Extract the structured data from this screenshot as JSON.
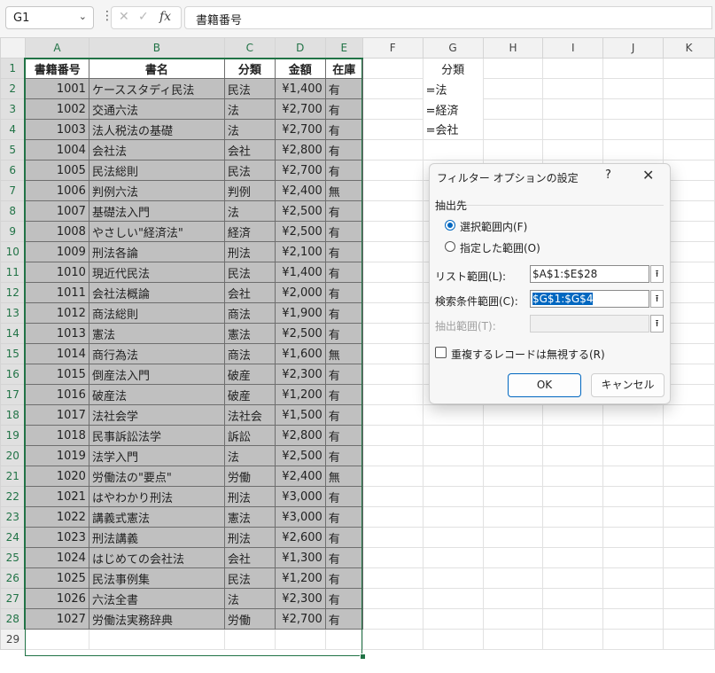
{
  "formula_bar": {
    "name_box": "G1",
    "formula": "書籍番号",
    "fx_label": "fx",
    "cancel_glyph": "✕",
    "enter_glyph": "✓",
    "separator": "⋮",
    "dropdown_glyph": "⌄"
  },
  "columns": [
    "A",
    "B",
    "C",
    "D",
    "E",
    "F",
    "G",
    "H",
    "I",
    "J",
    "K"
  ],
  "rows": [
    "1",
    "2",
    "3",
    "4",
    "5",
    "6",
    "7",
    "8",
    "9",
    "10",
    "11",
    "12",
    "13",
    "14",
    "15",
    "16",
    "17",
    "18",
    "19",
    "20",
    "21",
    "22",
    "23",
    "24",
    "25",
    "26",
    "27",
    "28",
    "29"
  ],
  "table": {
    "headers": [
      "書籍番号",
      "書名",
      "分類",
      "金額",
      "在庫"
    ],
    "data": [
      [
        "1001",
        "ケーススタディ民法",
        "民法",
        "¥1,400",
        "有"
      ],
      [
        "1002",
        "交通六法",
        "法",
        "¥2,700",
        "有"
      ],
      [
        "1003",
        "法人税法の基礎",
        "法",
        "¥2,700",
        "有"
      ],
      [
        "1004",
        "会社法",
        "会社",
        "¥2,800",
        "有"
      ],
      [
        "1005",
        "民法総則",
        "民法",
        "¥2,700",
        "有"
      ],
      [
        "1006",
        "判例六法",
        "判例",
        "¥2,400",
        "無"
      ],
      [
        "1007",
        "基礎法入門",
        "法",
        "¥2,500",
        "有"
      ],
      [
        "1008",
        "やさしい\"経済法\"",
        "経済",
        "¥2,500",
        "有"
      ],
      [
        "1009",
        "刑法各論",
        "刑法",
        "¥2,100",
        "有"
      ],
      [
        "1010",
        "現近代民法",
        "民法",
        "¥1,400",
        "有"
      ],
      [
        "1011",
        "会社法概論",
        "会社",
        "¥2,000",
        "有"
      ],
      [
        "1012",
        "商法総則",
        "商法",
        "¥1,900",
        "有"
      ],
      [
        "1013",
        "憲法",
        "憲法",
        "¥2,500",
        "有"
      ],
      [
        "1014",
        "商行為法",
        "商法",
        "¥1,600",
        "無"
      ],
      [
        "1015",
        "倒産法入門",
        "破産",
        "¥2,300",
        "有"
      ],
      [
        "1016",
        "破産法",
        "破産",
        "¥1,200",
        "有"
      ],
      [
        "1017",
        "法社会学",
        "法社会",
        "¥1,500",
        "有"
      ],
      [
        "1018",
        "民事訴訟法学",
        "訴訟",
        "¥2,800",
        "有"
      ],
      [
        "1019",
        "法学入門",
        "法",
        "¥2,500",
        "有"
      ],
      [
        "1020",
        "労働法の\"要点\"",
        "労働",
        "¥2,400",
        "無"
      ],
      [
        "1021",
        "はやわかり刑法",
        "刑法",
        "¥3,000",
        "有"
      ],
      [
        "1022",
        "講義式憲法",
        "憲法",
        "¥3,000",
        "有"
      ],
      [
        "1023",
        "刑法講義",
        "刑法",
        "¥2,600",
        "有"
      ],
      [
        "1024",
        "はじめての会社法",
        "会社",
        "¥1,300",
        "有"
      ],
      [
        "1025",
        "民法事例集",
        "民法",
        "¥1,200",
        "有"
      ],
      [
        "1026",
        "六法全書",
        "法",
        "¥2,300",
        "有"
      ],
      [
        "1027",
        "労働法実務辞典",
        "労働",
        "¥2,700",
        "有"
      ]
    ]
  },
  "criteria": [
    "分類",
    "=法",
    "=経済",
    "=会社"
  ],
  "dialog": {
    "title": "フィルター オプションの設定",
    "help": "?",
    "close": "✕",
    "group_label": "抽出先",
    "radio_in_place": "選択範囲内(F)",
    "radio_copy": "指定した範囲(O)",
    "list_range_label": "リスト範囲(L):",
    "list_range_value": "$A$1:$E$28",
    "criteria_range_label": "検索条件範囲(C):",
    "criteria_range_value": "$G$1:$G$4",
    "copy_to_label": "抽出範囲(T):",
    "copy_to_value": "",
    "range_button_glyph": "⭱",
    "unique_label": "重複するレコードは無視する(R)",
    "ok_label": "OK",
    "cancel_label": "キャンセル"
  }
}
